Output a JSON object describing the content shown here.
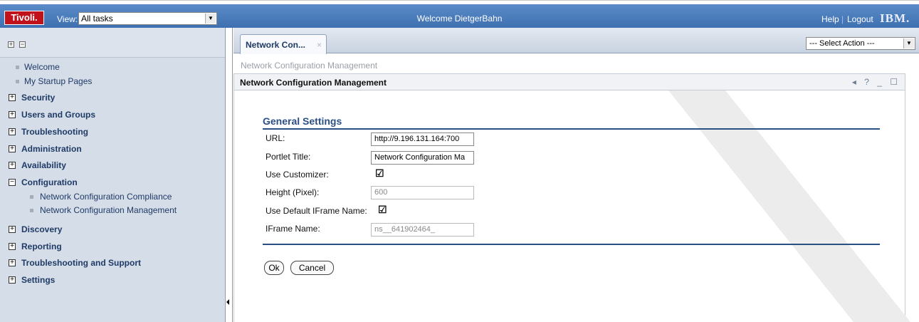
{
  "header": {
    "logo": "Tivoli.",
    "view_label": "View:",
    "view_value": "All tasks",
    "welcome": "Welcome DietgerBahn",
    "help": "Help",
    "separator": "|",
    "logout": "Logout",
    "ibm": "IBM."
  },
  "nav": {
    "expand_all": "+",
    "collapse_all": "−",
    "items": [
      {
        "label": "Welcome",
        "kind": "link"
      },
      {
        "label": "My Startup Pages",
        "kind": "link"
      },
      {
        "label": "Security",
        "kind": "collapsed"
      },
      {
        "label": "Users and Groups",
        "kind": "collapsed"
      },
      {
        "label": "Troubleshooting",
        "kind": "collapsed"
      },
      {
        "label": "Administration",
        "kind": "collapsed"
      },
      {
        "label": "Availability",
        "kind": "collapsed"
      },
      {
        "label": "Configuration",
        "kind": "expanded"
      },
      {
        "label": "Network Configuration Compliance",
        "kind": "child"
      },
      {
        "label": "Network Configuration Management",
        "kind": "child"
      },
      {
        "label": "Discovery",
        "kind": "collapsed"
      },
      {
        "label": "Reporting",
        "kind": "collapsed"
      },
      {
        "label": "Troubleshooting and Support",
        "kind": "collapsed"
      },
      {
        "label": "Settings",
        "kind": "collapsed"
      }
    ]
  },
  "tab": {
    "label": "Network Con...",
    "close": "×"
  },
  "action_select": "--- Select Action ---",
  "breadcrumb": "Network Configuration Management",
  "portlet": {
    "title": "Network Configuration Management",
    "controls": "◂ ? _ ☐"
  },
  "form": {
    "section_title": "General Settings",
    "url_label": "URL:",
    "url_value": "http://9.196.131.164:700",
    "portlet_title_label": "Portlet Title:",
    "portlet_title_value": "Network Configuration Ma",
    "use_customizer_label": "Use Customizer:",
    "use_customizer_checked": true,
    "height_label": "Height (Pixel):",
    "height_value": "600",
    "use_default_iframe_label": "Use Default IFrame Name:",
    "use_default_iframe_checked": true,
    "iframe_name_label": "IFrame Name:",
    "iframe_name_value": "ns__641902464_",
    "ok": "Ok",
    "cancel": "Cancel",
    "check_glyph": "☑"
  },
  "colors": {
    "header_blue": "#3e6fb0",
    "nav_bg": "#d5dde8",
    "section_blue": "#2a4f85",
    "logo_red": "#c1121c"
  }
}
